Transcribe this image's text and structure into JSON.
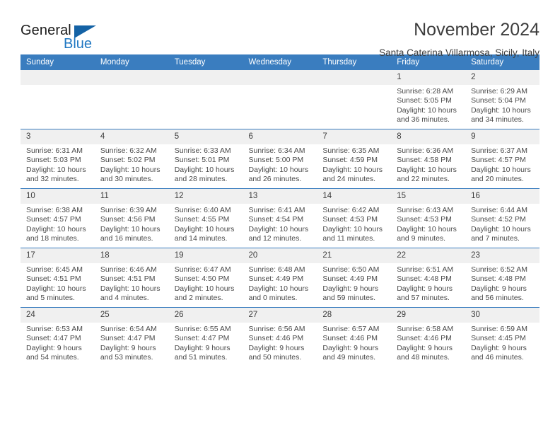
{
  "logo": {
    "word_top": "General",
    "word_bottom": "Blue",
    "accent_color": "#1462a5",
    "blue_text_color": "#1f77c2"
  },
  "header": {
    "title": "November 2024",
    "subtitle": "Santa Caterina Villarmosa, Sicily, Italy"
  },
  "theme": {
    "header_row_bg": "#3a7dbf",
    "daynum_bg": "#f0f0f0",
    "text_color": "#4a4a4a"
  },
  "calendar": {
    "weekday_headers": [
      "Sunday",
      "Monday",
      "Tuesday",
      "Wednesday",
      "Thursday",
      "Friday",
      "Saturday"
    ],
    "labels": {
      "sunrise_prefix": "Sunrise:",
      "sunset_prefix": "Sunset:",
      "daylight_prefix": "Daylight:"
    },
    "weeks": [
      [
        {
          "day": "",
          "sunrise": "",
          "sunset": "",
          "daylight": "",
          "empty": true
        },
        {
          "day": "",
          "sunrise": "",
          "sunset": "",
          "daylight": "",
          "empty": true
        },
        {
          "day": "",
          "sunrise": "",
          "sunset": "",
          "daylight": "",
          "empty": true
        },
        {
          "day": "",
          "sunrise": "",
          "sunset": "",
          "daylight": "",
          "empty": true
        },
        {
          "day": "",
          "sunrise": "",
          "sunset": "",
          "daylight": "",
          "empty": true
        },
        {
          "day": "1",
          "sunrise": "Sunrise: 6:28 AM",
          "sunset": "Sunset: 5:05 PM",
          "daylight": "Daylight: 10 hours and 36 minutes.",
          "empty": false
        },
        {
          "day": "2",
          "sunrise": "Sunrise: 6:29 AM",
          "sunset": "Sunset: 5:04 PM",
          "daylight": "Daylight: 10 hours and 34 minutes.",
          "empty": false
        }
      ],
      [
        {
          "day": "3",
          "sunrise": "Sunrise: 6:31 AM",
          "sunset": "Sunset: 5:03 PM",
          "daylight": "Daylight: 10 hours and 32 minutes.",
          "empty": false
        },
        {
          "day": "4",
          "sunrise": "Sunrise: 6:32 AM",
          "sunset": "Sunset: 5:02 PM",
          "daylight": "Daylight: 10 hours and 30 minutes.",
          "empty": false
        },
        {
          "day": "5",
          "sunrise": "Sunrise: 6:33 AM",
          "sunset": "Sunset: 5:01 PM",
          "daylight": "Daylight: 10 hours and 28 minutes.",
          "empty": false
        },
        {
          "day": "6",
          "sunrise": "Sunrise: 6:34 AM",
          "sunset": "Sunset: 5:00 PM",
          "daylight": "Daylight: 10 hours and 26 minutes.",
          "empty": false
        },
        {
          "day": "7",
          "sunrise": "Sunrise: 6:35 AM",
          "sunset": "Sunset: 4:59 PM",
          "daylight": "Daylight: 10 hours and 24 minutes.",
          "empty": false
        },
        {
          "day": "8",
          "sunrise": "Sunrise: 6:36 AM",
          "sunset": "Sunset: 4:58 PM",
          "daylight": "Daylight: 10 hours and 22 minutes.",
          "empty": false
        },
        {
          "day": "9",
          "sunrise": "Sunrise: 6:37 AM",
          "sunset": "Sunset: 4:57 PM",
          "daylight": "Daylight: 10 hours and 20 minutes.",
          "empty": false
        }
      ],
      [
        {
          "day": "10",
          "sunrise": "Sunrise: 6:38 AM",
          "sunset": "Sunset: 4:57 PM",
          "daylight": "Daylight: 10 hours and 18 minutes.",
          "empty": false
        },
        {
          "day": "11",
          "sunrise": "Sunrise: 6:39 AM",
          "sunset": "Sunset: 4:56 PM",
          "daylight": "Daylight: 10 hours and 16 minutes.",
          "empty": false
        },
        {
          "day": "12",
          "sunrise": "Sunrise: 6:40 AM",
          "sunset": "Sunset: 4:55 PM",
          "daylight": "Daylight: 10 hours and 14 minutes.",
          "empty": false
        },
        {
          "day": "13",
          "sunrise": "Sunrise: 6:41 AM",
          "sunset": "Sunset: 4:54 PM",
          "daylight": "Daylight: 10 hours and 12 minutes.",
          "empty": false
        },
        {
          "day": "14",
          "sunrise": "Sunrise: 6:42 AM",
          "sunset": "Sunset: 4:53 PM",
          "daylight": "Daylight: 10 hours and 11 minutes.",
          "empty": false
        },
        {
          "day": "15",
          "sunrise": "Sunrise: 6:43 AM",
          "sunset": "Sunset: 4:53 PM",
          "daylight": "Daylight: 10 hours and 9 minutes.",
          "empty": false
        },
        {
          "day": "16",
          "sunrise": "Sunrise: 6:44 AM",
          "sunset": "Sunset: 4:52 PM",
          "daylight": "Daylight: 10 hours and 7 minutes.",
          "empty": false
        }
      ],
      [
        {
          "day": "17",
          "sunrise": "Sunrise: 6:45 AM",
          "sunset": "Sunset: 4:51 PM",
          "daylight": "Daylight: 10 hours and 5 minutes.",
          "empty": false
        },
        {
          "day": "18",
          "sunrise": "Sunrise: 6:46 AM",
          "sunset": "Sunset: 4:51 PM",
          "daylight": "Daylight: 10 hours and 4 minutes.",
          "empty": false
        },
        {
          "day": "19",
          "sunrise": "Sunrise: 6:47 AM",
          "sunset": "Sunset: 4:50 PM",
          "daylight": "Daylight: 10 hours and 2 minutes.",
          "empty": false
        },
        {
          "day": "20",
          "sunrise": "Sunrise: 6:48 AM",
          "sunset": "Sunset: 4:49 PM",
          "daylight": "Daylight: 10 hours and 0 minutes.",
          "empty": false
        },
        {
          "day": "21",
          "sunrise": "Sunrise: 6:50 AM",
          "sunset": "Sunset: 4:49 PM",
          "daylight": "Daylight: 9 hours and 59 minutes.",
          "empty": false
        },
        {
          "day": "22",
          "sunrise": "Sunrise: 6:51 AM",
          "sunset": "Sunset: 4:48 PM",
          "daylight": "Daylight: 9 hours and 57 minutes.",
          "empty": false
        },
        {
          "day": "23",
          "sunrise": "Sunrise: 6:52 AM",
          "sunset": "Sunset: 4:48 PM",
          "daylight": "Daylight: 9 hours and 56 minutes.",
          "empty": false
        }
      ],
      [
        {
          "day": "24",
          "sunrise": "Sunrise: 6:53 AM",
          "sunset": "Sunset: 4:47 PM",
          "daylight": "Daylight: 9 hours and 54 minutes.",
          "empty": false
        },
        {
          "day": "25",
          "sunrise": "Sunrise: 6:54 AM",
          "sunset": "Sunset: 4:47 PM",
          "daylight": "Daylight: 9 hours and 53 minutes.",
          "empty": false
        },
        {
          "day": "26",
          "sunrise": "Sunrise: 6:55 AM",
          "sunset": "Sunset: 4:47 PM",
          "daylight": "Daylight: 9 hours and 51 minutes.",
          "empty": false
        },
        {
          "day": "27",
          "sunrise": "Sunrise: 6:56 AM",
          "sunset": "Sunset: 4:46 PM",
          "daylight": "Daylight: 9 hours and 50 minutes.",
          "empty": false
        },
        {
          "day": "28",
          "sunrise": "Sunrise: 6:57 AM",
          "sunset": "Sunset: 4:46 PM",
          "daylight": "Daylight: 9 hours and 49 minutes.",
          "empty": false
        },
        {
          "day": "29",
          "sunrise": "Sunrise: 6:58 AM",
          "sunset": "Sunset: 4:46 PM",
          "daylight": "Daylight: 9 hours and 48 minutes.",
          "empty": false
        },
        {
          "day": "30",
          "sunrise": "Sunrise: 6:59 AM",
          "sunset": "Sunset: 4:45 PM",
          "daylight": "Daylight: 9 hours and 46 minutes.",
          "empty": false
        }
      ]
    ]
  }
}
